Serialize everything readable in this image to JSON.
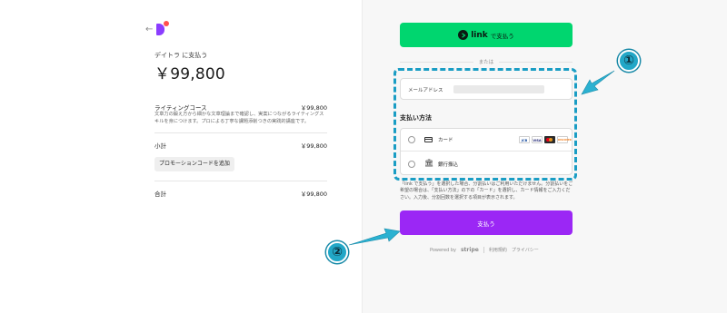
{
  "checkout": {
    "back_icon": "back-arrow-icon",
    "merchant_line": "デイトラ に支払う",
    "total_amount": "￥99,800",
    "item": {
      "name": "ライティングコース",
      "price": "￥99,800",
      "description": "文章力の鍛え方から細かな文章理論まで確認し、実案につながるライティングスキルを身につけます。プロによる丁寧な課題添削つきの実践的講座です。"
    },
    "subtotal_label": "小計",
    "subtotal_value": "￥99,800",
    "promo_button": "プロモーションコードを追加",
    "total_label": "合計",
    "total_value": "￥99,800"
  },
  "payment": {
    "link_button": {
      "brand": "link",
      "suffix": "で支払う"
    },
    "or_text": "または",
    "email_label": "メールアドレス",
    "method_title": "支払い方法",
    "methods": [
      {
        "label": "カード",
        "icon": "credit-card-icon",
        "brands": [
          "JCB",
          "VISA",
          "MC",
          "DISCOVER"
        ]
      },
      {
        "label": "銀行振込",
        "icon": "bank-icon"
      }
    ],
    "notice": "「link で支払う」を選択した場合、分割払いはご利用いただけません。分割払いをご希望の場合は、「支払い方法」の下の「カード」を選択し、カード情報をご入力ください。入力後、分割回数を選択する項目が表示されます。",
    "pay_button": "支払う"
  },
  "footer": {
    "powered_by": "Powered by",
    "stripe": "stripe",
    "terms": "利用規約",
    "privacy": "プライバシー"
  },
  "annotations": {
    "badge_1": "①",
    "badge_2": "②",
    "color": "#22a7c7"
  },
  "colors": {
    "link_green": "#00d66f",
    "pay_purple": "#9b27f5",
    "logo_purple": "#8b3dff",
    "highlight": "#1a9dc4"
  }
}
